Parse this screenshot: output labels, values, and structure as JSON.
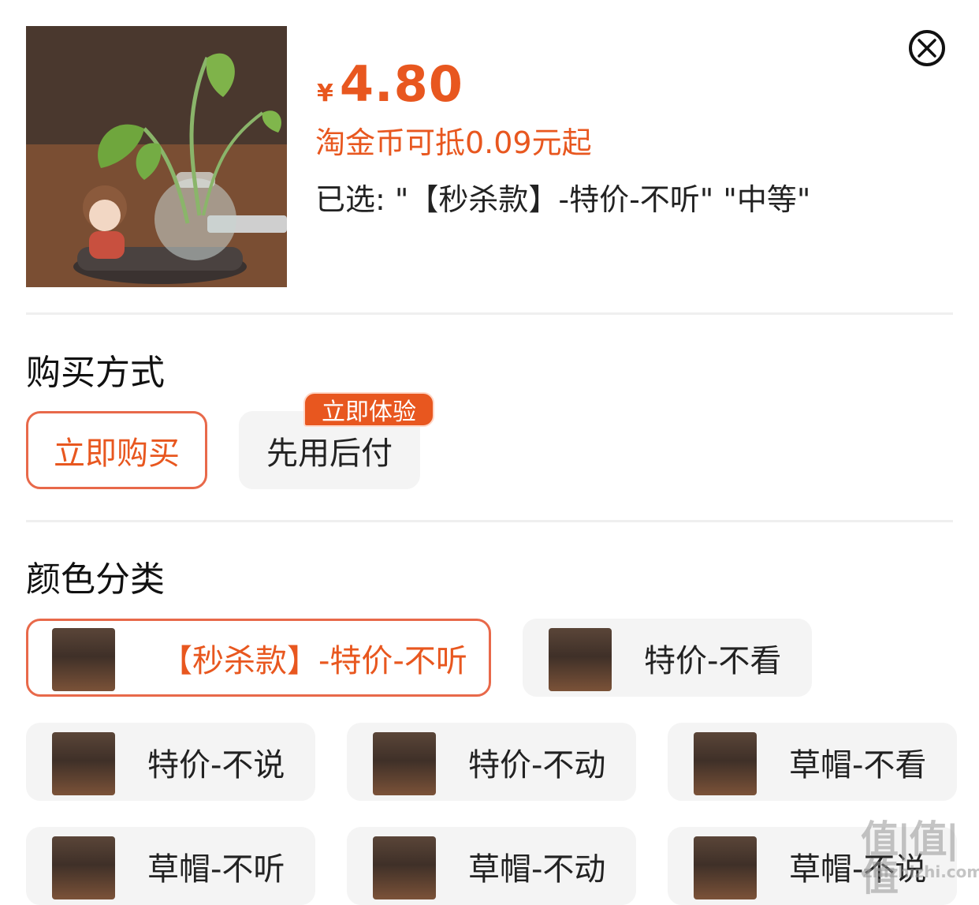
{
  "header": {
    "price_symbol": "¥",
    "price": "4.80",
    "coin_deduction": "淘金币可抵0.09元起",
    "selected": "已选: \"【秒杀款】-特价-不听\" \"中等\"",
    "close_icon": "close-circle-icon"
  },
  "purchase_method": {
    "title": "购买方式",
    "options": [
      {
        "label": "立即购买",
        "selected": true
      },
      {
        "label": "先用后付",
        "selected": false,
        "badge": "立即体验"
      }
    ]
  },
  "color_category": {
    "title": "颜色分类",
    "options": [
      {
        "label": "【秒杀款】-特价-不听",
        "selected": true
      },
      {
        "label": "特价-不看",
        "selected": false
      },
      {
        "label": "特价-不说",
        "selected": false
      },
      {
        "label": "特价-不动",
        "selected": false
      },
      {
        "label": "草帽-不看",
        "selected": false
      },
      {
        "label": "草帽-不听",
        "selected": false
      },
      {
        "label": "草帽-不动",
        "selected": false
      },
      {
        "label": "草帽-不说",
        "selected": false
      }
    ]
  },
  "watermark": {
    "main": "值|值|值",
    "sub": "zhizhizhi.com"
  },
  "colors": {
    "accent": "#e8571f",
    "chip_bg": "#f4f4f4",
    "active_border": "#e8694a"
  }
}
